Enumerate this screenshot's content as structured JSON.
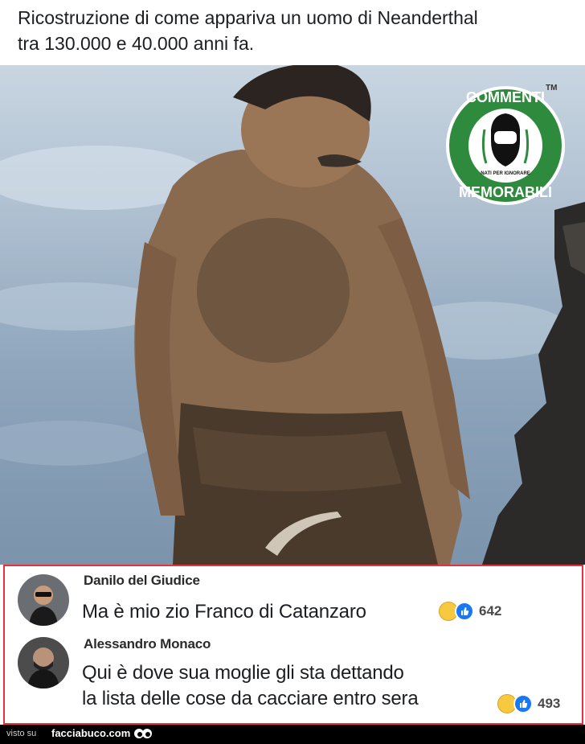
{
  "post": {
    "caption_line1": "Ricostruzione di come appariva un uomo di Neanderthal",
    "caption_line2": "tra 130.000 e 40.000 anni fa."
  },
  "badge": {
    "top_text": "COMMENTI",
    "bottom_text": "MEMORABILI",
    "small_text": "NATI PER IGNORARE",
    "tm": "TM",
    "color": "#2e8b3e"
  },
  "comments": [
    {
      "author": "Danilo del Giudice",
      "lines": [
        "Ma è mio zio Franco di Catanzaro"
      ],
      "reaction_count": "642"
    },
    {
      "author": "Alessandro Monaco",
      "lines": [
        "Qui è dove sua moglie gli sta dettando",
        "la lista delle cose da cacciare entro sera"
      ],
      "reaction_count": "493"
    }
  ],
  "footer": {
    "label": "visto su",
    "site": "facciabuco.com"
  },
  "colors": {
    "highlight_border": "#e5323c",
    "like_blue": "#1877f2"
  }
}
